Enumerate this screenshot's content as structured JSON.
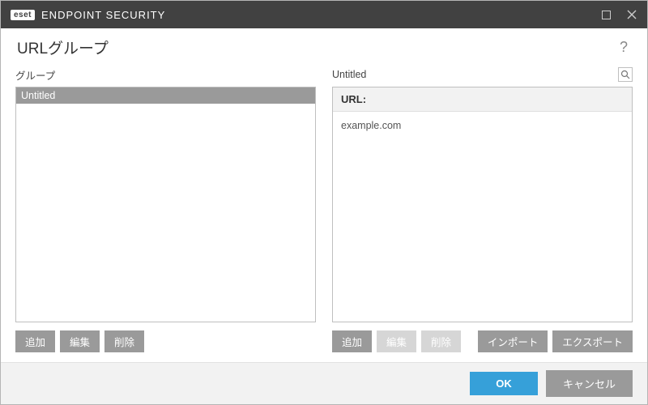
{
  "titlebar": {
    "badge": "eset",
    "product": "ENDPOINT SECURITY"
  },
  "header": {
    "title": "URLグループ",
    "help": "?"
  },
  "left": {
    "label": "グループ",
    "items": [
      {
        "name": "Untitled"
      }
    ],
    "buttons": {
      "add": "追加",
      "edit": "編集",
      "delete": "削除"
    }
  },
  "right": {
    "label": "Untitled",
    "url_header": "URL:",
    "urls": [
      "example.com"
    ],
    "buttons": {
      "add": "追加",
      "edit": "編集",
      "delete": "削除",
      "import": "インポート",
      "export": "エクスポート"
    }
  },
  "footer": {
    "ok": "OK",
    "cancel": "キャンセル"
  }
}
